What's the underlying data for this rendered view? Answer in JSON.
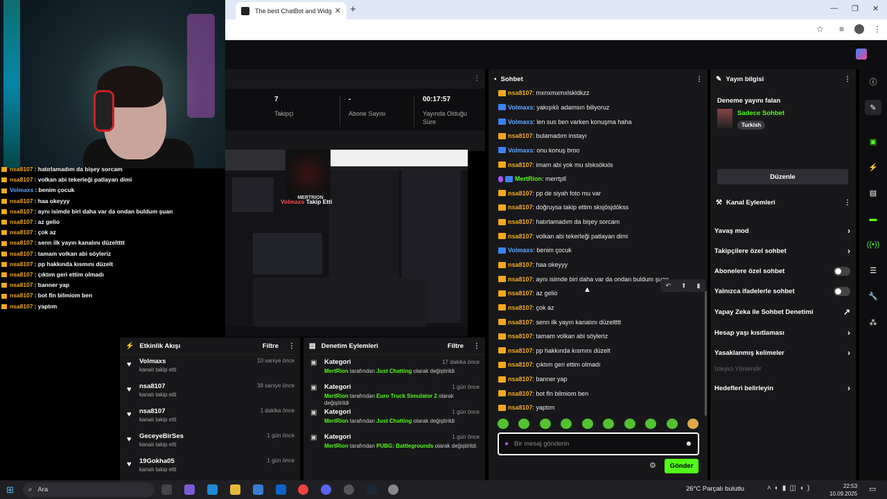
{
  "browser": {
    "tab_title": "The best ChatBot and Widgets",
    "tab_close": "✕",
    "new_tab": "+"
  },
  "overlay_chat": [
    {
      "user": "nsa8107",
      "text": " : hatırlamadım da bişey sorcam",
      "color": "gold"
    },
    {
      "user": "nsa8107",
      "text": " : volkan abi tekerleği patlayan dimi",
      "color": "gold"
    },
    {
      "user": "Volmaxs",
      "text": " : benim çocuk",
      "color": "blue"
    },
    {
      "user": "nsa8107",
      "text": " : haa okeyyy",
      "color": "gold"
    },
    {
      "user": "nsa8107",
      "text": " : aynı isimde biri daha var da ondan buldum şuan",
      "color": "gold"
    },
    {
      "user": "nsa8107",
      "text": " : az gelio",
      "color": "gold"
    },
    {
      "user": "nsa8107",
      "text": " : çok az",
      "color": "gold"
    },
    {
      "user": "nsa8107",
      "text": " : senn ilk yayın kanalını düzeltttt",
      "color": "gold"
    },
    {
      "user": "nsa8107",
      "text": " : tamam volkan abi söyleriz",
      "color": "gold"
    },
    {
      "user": "nsa8107",
      "text": " : pp hakkında kısmını düzelt",
      "color": "gold"
    },
    {
      "user": "nsa8107",
      "text": " : çıktım geri ettim olmadı",
      "color": "gold"
    },
    {
      "user": "nsa8107",
      "text": " : banner yap",
      "color": "gold"
    },
    {
      "user": "nsa8107",
      "text": " : bot fln bilmiom ben",
      "color": "gold"
    },
    {
      "user": "nsa8107",
      "text": " : yaptım",
      "color": "gold"
    }
  ],
  "stats": {
    "followers_value": "7",
    "followers_label": "Takipçi",
    "subs_value": "-",
    "subs_label": "Abone Sayısı",
    "time_value": "00:17:57",
    "time_label": "Yayında Olduğu Süre"
  },
  "preview": {
    "brand": "MERTRION",
    "follow_name": "Volmaxs",
    "follow_text": " Takip Etti"
  },
  "events": {
    "title": "Etkinlik Akışı",
    "filter": "Filtre",
    "items": [
      {
        "name": "Volmaxs",
        "time": "10 saniye önce",
        "sub": "kanalı takip etti"
      },
      {
        "name": "nsa8107",
        "time": "38 saniye önce",
        "sub": "kanalı takip etti"
      },
      {
        "name": "nsa8107",
        "time": "1 dakika önce",
        "sub": "kanalı takip etti"
      },
      {
        "name": "GeceyeBirSes",
        "time": "1 gün önce",
        "sub": "kanalı takip etti"
      },
      {
        "name": "19Gokha05",
        "time": "1 gün önce",
        "sub": "kanalı takip etti"
      }
    ]
  },
  "mod": {
    "title": "Denetim Eylemleri",
    "filter": "Filtre",
    "items": [
      {
        "name": "Kategori",
        "time": "17 dakika önce",
        "user": "MertRion",
        "mid": " tarafından ",
        "game": "Just Chatting",
        "end": " olarak değiştirildi"
      },
      {
        "name": "Kategori",
        "time": "1 gün önce",
        "user": "MertRion",
        "mid": " tarafından ",
        "game": "Euro Truck Simulator 2",
        "end": " olarak değiştirildi"
      },
      {
        "name": "Kategori",
        "time": "1 gün önce",
        "user": "MertRion",
        "mid": " tarafından ",
        "game": "Just Chatting",
        "end": " olarak değiştirildi"
      },
      {
        "name": "Kategori",
        "time": "1 gün önce",
        "user": "MertRion",
        "mid": " tarafından ",
        "game": "PUBG: Battlegrounds",
        "end": " olarak değiştirildi"
      }
    ]
  },
  "chat": {
    "title": "Sohbet",
    "placeholder": "Bir mesaj gönderin",
    "send": "Gönder",
    "messages": [
      {
        "user": "nsa8107",
        "text": ": mxnxmxmxlskldkzz",
        "badge": "cr",
        "color": "gold"
      },
      {
        "user": "Volmaxs",
        "text": ": yakışıklı adamsın biliyoruz",
        "badge": "bl",
        "color": "blue"
      },
      {
        "user": "Volmaxs",
        "text": ": len sus ben varken konuşma haha",
        "badge": "bl",
        "color": "blue"
      },
      {
        "user": "nsa8107",
        "text": ": bulamadım instayı",
        "badge": "cr",
        "color": "gold"
      },
      {
        "user": "Volmaxs",
        "text": ": onu konuş broo",
        "badge": "bl",
        "color": "blue"
      },
      {
        "user": "nsa8107",
        "text": ": imam abi yok mu slsksökxls",
        "badge": "cr",
        "color": "gold"
      },
      {
        "user": "MertRion",
        "text": ": merrtpll",
        "badge": "vi",
        "color": "green"
      },
      {
        "user": "nsa8107",
        "text": ": pp de siyah foto mu var",
        "badge": "cr",
        "color": "gold"
      },
      {
        "user": "nsa8107",
        "text": ": doğruysa takip ettim sksjösjdökss",
        "badge": "cr",
        "color": "gold"
      },
      {
        "user": "nsa8107",
        "text": ": hatırlamadım da bişey sorcam",
        "badge": "cr",
        "color": "gold"
      },
      {
        "user": "nsa8107",
        "text": ": volkan abi tekerleği patlayan dimi",
        "badge": "cr",
        "color": "gold"
      },
      {
        "user": "Volmaxs",
        "text": ": benim çocuk",
        "badge": "bl",
        "color": "blue"
      },
      {
        "user": "nsa8107",
        "text": ": haa okeyyy",
        "badge": "cr",
        "color": "gold"
      },
      {
        "user": "nsa8107",
        "text": ": aynı isimde biri daha var da ondan buldum şuan",
        "badge": "cr",
        "color": "gold"
      },
      {
        "user": "nsa8107",
        "text": ": az gelio",
        "badge": "cr",
        "color": "gold"
      },
      {
        "user": "nsa8107",
        "text": ": çok az",
        "badge": "cr",
        "color": "gold"
      },
      {
        "user": "nsa8107",
        "text": ": senn ilk yayın kanalını düzeltttt",
        "badge": "cr",
        "color": "gold"
      },
      {
        "user": "nsa8107",
        "text": ": tamam volkan abi söyleriz",
        "badge": "cr",
        "color": "gold"
      },
      {
        "user": "nsa8107",
        "text": ": pp hakkında kısmını düzelt",
        "badge": "cr",
        "color": "gold"
      },
      {
        "user": "nsa8107",
        "text": ": çıktım geri ettim olmadı",
        "badge": "cr",
        "color": "gold"
      },
      {
        "user": "nsa8107",
        "text": ": banner yap",
        "badge": "cr",
        "color": "gold"
      },
      {
        "user": "nsa8107",
        "text": ": bot fln bilmiom ben",
        "badge": "cr",
        "color": "gold"
      },
      {
        "user": "nsa8107",
        "text": ": yaptım",
        "badge": "cr",
        "color": "gold"
      }
    ]
  },
  "info": {
    "title": "Yayın bilgisi",
    "stream_title": "Deneme yayını falan",
    "category": "Sadece Sohbet",
    "tag": "Turkish",
    "edit": "Düzenle"
  },
  "actions": {
    "title": "Kanal Eylemleri",
    "items": [
      {
        "label": "Yavaş mod",
        "kind": "arrow"
      },
      {
        "label": "Takipçilere özel sohbet",
        "kind": "arrow"
      },
      {
        "label": "Abonelere özel sohbet",
        "kind": "toggle"
      },
      {
        "label": "Yalnızca ifadelerle sohbet",
        "kind": "toggle"
      },
      {
        "label": "Yapay Zeka ile Sohbet Denetimi",
        "kind": "ext"
      },
      {
        "label": "Hesap yaşı kısıtlaması",
        "kind": "arrow"
      },
      {
        "label": "Yasaklanmış kelimeler",
        "kind": "arrow"
      },
      {
        "label": "İzleyici Yönlendir",
        "kind": "dim"
      },
      {
        "label": "Hedefleri belirleyin",
        "kind": "arrow"
      }
    ]
  },
  "taskbar": {
    "search": "Ara",
    "weather": "26°C  Parçalı bulutlu",
    "time": "22:53",
    "date": "10.09.2025"
  },
  "colors": {
    "kick_green": "#53fc18",
    "gold": "#f3a91d",
    "blue": "#5aa7ff",
    "panel": "#18181b"
  }
}
